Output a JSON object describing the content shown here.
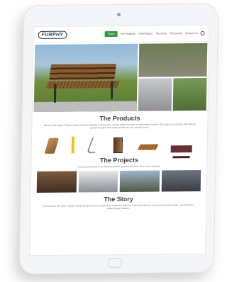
{
  "nav": {
    "logo": "FURPHY",
    "items": [
      {
        "label": "Home",
        "active": true
      },
      {
        "label": "The Products",
        "active": false
      },
      {
        "label": "The Projects",
        "active": false
      },
      {
        "label": "The Story",
        "active": false
      },
      {
        "label": "The Events",
        "active": false
      },
      {
        "label": "Contact Us",
        "active": false
      }
    ]
  },
  "products": {
    "title": "The Products",
    "subtitle": "We're a wide range of Original Furphy Foundry designed in Shepparton, and the ability to enable our tailor-made solutions. We support you at every step and can provide the right urban design product for your specific project."
  },
  "projects": {
    "title": "The Projects",
    "subtitle": "Here you'll find some of our featured projects, products and news from around Australia."
  },
  "story": {
    "title": "The Story",
    "subtitle": "Over the past 150 years, Furphy Foundry has grown from an agricultural implement maker, to a diversified foundry and manufacturing company - specialising in Urban Design Products."
  }
}
